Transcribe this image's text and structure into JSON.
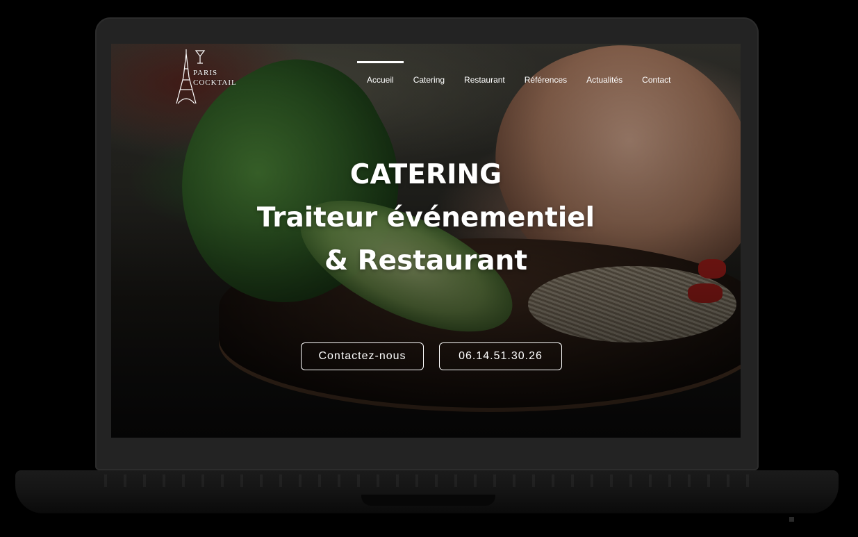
{
  "logo": {
    "line1": "PARIS",
    "line2": "COCKTAIL"
  },
  "nav": {
    "items": [
      {
        "label": "Accueil",
        "active": true
      },
      {
        "label": "Catering",
        "active": false
      },
      {
        "label": "Restaurant",
        "active": false
      },
      {
        "label": "Références",
        "active": false
      },
      {
        "label": "Actualités",
        "active": false
      },
      {
        "label": "Contact",
        "active": false
      }
    ]
  },
  "hero": {
    "line1": "CATERING",
    "line2": "Traiteur événementiel",
    "line3": "& Restaurant"
  },
  "cta": {
    "contact_label": "Contactez-nous",
    "phone_label": "06.14.51.30.26"
  },
  "colors": {
    "text": "#ffffff",
    "bezel": "#232323",
    "background": "#000000"
  }
}
